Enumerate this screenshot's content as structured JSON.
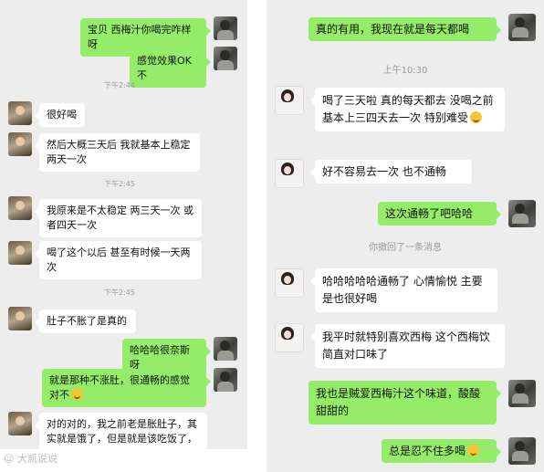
{
  "left": {
    "timestamps": [
      "下午2:44",
      "下午2:45",
      "下午2:45"
    ],
    "messages": [
      {
        "side": "sent",
        "text": "宝贝 西梅汁你喝完咋样呀"
      },
      {
        "side": "sent",
        "text": "感觉效果OK不"
      },
      {
        "side": "recv",
        "text": "很好喝"
      },
      {
        "side": "recv",
        "text": "然后大概三天后 我就基本上稳定两天一次"
      },
      {
        "side": "recv",
        "text": "我原来是不太稳定 两三天一次 或者四天一次"
      },
      {
        "side": "recv",
        "text": "喝了这个以后 甚至有时候一天两次"
      },
      {
        "side": "recv",
        "text": "肚子不胀了是真的"
      },
      {
        "side": "sent",
        "text": "哈哈哈很奈斯呀"
      },
      {
        "side": "sent",
        "text": "就是那种不涨肚，很通畅的感觉对不"
      },
      {
        "side": "recv",
        "text": "对的对的，我之前老是胀肚子，其实就是饿了，但是就是该吃饭了，"
      }
    ],
    "watermark": "大凯说说"
  },
  "right": {
    "timestamp": "上午10:30",
    "recall_notice": "你撤回了一条消息",
    "messages": [
      {
        "side": "sent",
        "text": "真的有用，我现在就是每天都喝"
      },
      {
        "side": "recv",
        "text": "喝了三天啦 真的每天都去 没喝之前基本上三四天去一次 特别难受"
      },
      {
        "side": "recv",
        "text": "好不容易去一次 也不通畅"
      },
      {
        "side": "sent",
        "text": "这次通畅了吧哈哈"
      },
      {
        "side": "recv",
        "text": "哈哈哈哈哈通畅了 心情愉悦 主要是也很好喝"
      },
      {
        "side": "recv",
        "text": "我平时就特别喜欢西梅 这个西梅饮简直对口味了"
      },
      {
        "side": "sent",
        "text": "我也是贼爱西梅汁这个味道，酸酸甜甜的"
      },
      {
        "side": "sent",
        "text": "总是忍不住多喝"
      }
    ]
  },
  "colors": {
    "sent_bubble": "#95ec69",
    "recv_bubble": "#ffffff",
    "background": "#ededed"
  }
}
